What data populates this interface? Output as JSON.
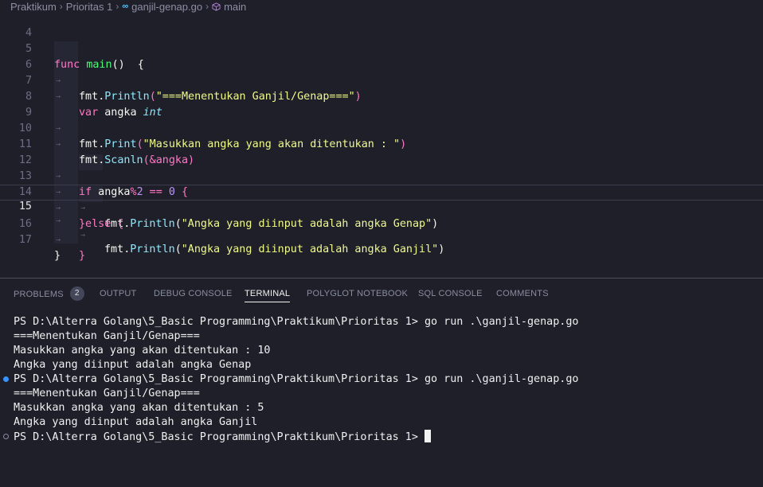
{
  "breadcrumb": {
    "items": [
      "Praktikum",
      "Prioritas 1",
      "ganjil-genap.go",
      "main"
    ],
    "go_icon_label": "∞"
  },
  "editor": {
    "line_numbers": [
      "4",
      "5",
      "6",
      "7",
      "8",
      "9",
      "10",
      "11",
      "12",
      "13",
      "14",
      "15",
      "16",
      "17"
    ],
    "current_line": "15",
    "lines": {
      "l5": {
        "kw": "func",
        "fn": "main",
        "rest": "()  {"
      },
      "l6": {
        "pkg": "fmt",
        "dot": ".",
        "mth": "Println",
        "open": "(",
        "str": "\"===Menentukan Ganjil/Genap===\"",
        "close": ")"
      },
      "l7": {
        "kw": "var",
        "name": " angka ",
        "typ": "int"
      },
      "l9": {
        "pkg": "fmt",
        "dot": ".",
        "mth": "Print",
        "open": "(",
        "str": "\"Masukkan angka yang akan ditentukan : \"",
        "close": ")"
      },
      "l10": {
        "pkg": "fmt",
        "dot": ".",
        "mth": "Scanln",
        "rest": "(&angka)"
      },
      "l12": {
        "kw": "if",
        "name": " angka",
        "op": "%",
        "num1": "2",
        "op2": " == ",
        "num2": "0",
        "brace": " {"
      },
      "l13": {
        "pkg": "fmt",
        "dot": ".",
        "mth": "Println",
        "open": "(",
        "str": "\"Angka yang diinput adalah angka Genap\"",
        "close": ")"
      },
      "l14": {
        "text": "}else {"
      },
      "l15": {
        "pkg": "fmt",
        "dot": ".",
        "mth": "Println",
        "open": "(",
        "str": "\"Angka yang diinput adalah angka Ganjil\"",
        "close": ")"
      },
      "l16": {
        "text": "}"
      },
      "l17": {
        "text": "}"
      }
    }
  },
  "panel": {
    "tabs": [
      "PROBLEMS",
      "OUTPUT",
      "DEBUG CONSOLE",
      "TERMINAL",
      "POLYGLOT NOTEBOOK",
      "SQL CONSOLE",
      "COMMENTS"
    ],
    "problems_count": "2",
    "active_tab": "TERMINAL"
  },
  "terminal": {
    "lines": [
      "PS D:\\Alterra Golang\\5_Basic Programming\\Praktikum\\Prioritas 1> go run .\\ganjil-genap.go",
      "===Menentukan Ganjil/Genap===",
      "Masukkan angka yang akan ditentukan : 10",
      "Angka yang diinput adalah angka Genap",
      "PS D:\\Alterra Golang\\5_Basic Programming\\Praktikum\\Prioritas 1> go run .\\ganjil-genap.go",
      "===Menentukan Ganjil/Genap===",
      "Masukkan angka yang akan ditentukan : 5",
      "Angka yang diinput adalah angka Ganjil",
      "PS D:\\Alterra Golang\\5_Basic Programming\\Praktikum\\Prioritas 1>"
    ]
  },
  "colors": {
    "background": "#1e1f29",
    "keyword": "#ff79c6",
    "function": "#50fa7b",
    "string": "#f1fa8c",
    "type": "#8be9fd",
    "number": "#bd93f9",
    "status_dot_blue": "#3794ff"
  }
}
